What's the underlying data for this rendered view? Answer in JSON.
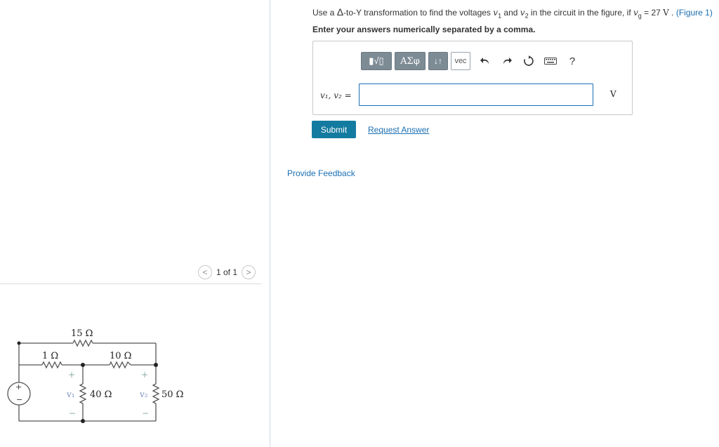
{
  "question": {
    "prefix": "Use a ",
    "delta": "Δ",
    "mid": "-to-Y transformation to find the voltages ",
    "v1": "v",
    "v1_sub": "1",
    "and": " and ",
    "v2": "v",
    "v2_sub": "2",
    "mid2": " in the circuit in the figure, if ",
    "vg": "v",
    "vg_sub": "g",
    "eq": " = 27 ",
    "unit": "V",
    "dot": " . ",
    "figure_link": "(Figure 1)"
  },
  "instruction": "Enter your answers numerically separated by a comma.",
  "toolbar": {
    "templates_label": "▮√▯",
    "greek_label": "ΑΣφ",
    "arrows_label": "↓↑",
    "vec_label": "vec",
    "undo_icon": "undo-icon",
    "redo_icon": "redo-icon",
    "reset_icon": "reset-icon",
    "keyboard_icon": "keyboard-icon",
    "help_label": "?"
  },
  "answer": {
    "variable_label": "v₁, v₂",
    "equals": " =",
    "value": "",
    "unit": "V"
  },
  "buttons": {
    "submit": "Submit",
    "request_answer": "Request Answer"
  },
  "feedback_link": "Provide Feedback",
  "pager": {
    "prev": "<",
    "text": "1 of 1",
    "next": ">"
  },
  "circuit": {
    "r1": "1 Ω",
    "r15": "15 Ω",
    "r10": "10 Ω",
    "r40": "40 Ω",
    "r50": "50 Ω",
    "v1_label": "v₁",
    "v2_label": "v₂",
    "plus": "+",
    "minus": "−"
  },
  "colors": {
    "accent": "#147ba0",
    "link": "#1a6fb3",
    "toolbar_button": "#7d8b95"
  }
}
